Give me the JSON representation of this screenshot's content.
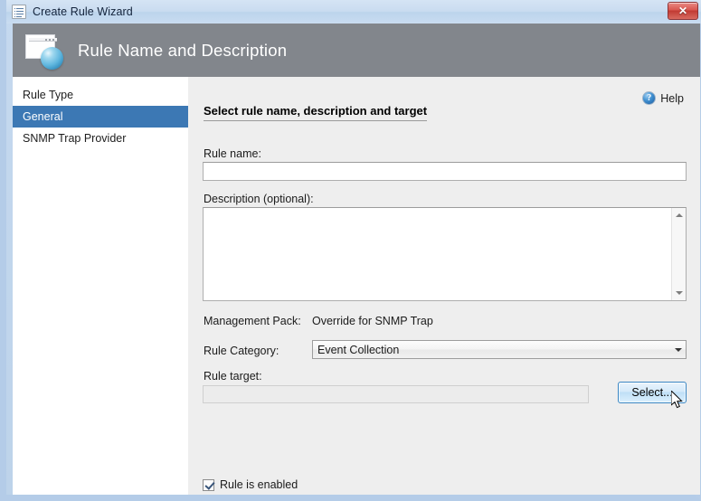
{
  "window": {
    "title": "Create Rule Wizard",
    "title_icon": "document-list-icon",
    "close_label": "✕"
  },
  "header": {
    "title": "Rule Name and Description",
    "icon": "wizard-page-sphere-icon",
    "background_color": "#82868c"
  },
  "sidebar": {
    "items": [
      {
        "label": "Rule Type",
        "selected": false
      },
      {
        "label": "General",
        "selected": true
      },
      {
        "label": "SNMP Trap Provider",
        "selected": false
      }
    ],
    "selected_color": "#3c78b4"
  },
  "main": {
    "help": {
      "label": "Help",
      "icon": "help-question-icon"
    },
    "section_title": "Select rule name, description and target",
    "fields": {
      "rule_name": {
        "label": "Rule name:",
        "value": "",
        "placeholder": ""
      },
      "description": {
        "label": "Description (optional):",
        "value": "",
        "placeholder": ""
      },
      "management_pack": {
        "label": "Management Pack:",
        "value": "Override for SNMP Trap"
      },
      "rule_category": {
        "label": "Rule Category:",
        "value": "Event Collection",
        "options": [
          "Event Collection"
        ]
      },
      "rule_target": {
        "label": "Rule target:",
        "value": "",
        "placeholder": "",
        "button_label": "Select..."
      }
    },
    "rule_enabled": {
      "label": "Rule is enabled",
      "checked": true
    }
  }
}
